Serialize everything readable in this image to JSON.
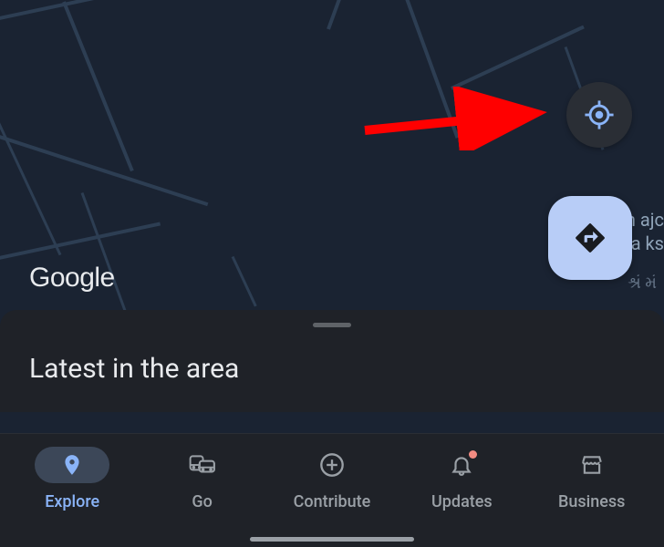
{
  "map": {
    "attribution": "Google",
    "poi_label": "Sh          ajc\nMa          ks",
    "poi_sub": "શ્રં\nમં"
  },
  "controls": {
    "locate_icon": "locate-crosshair-icon",
    "directions_icon": "directions-icon"
  },
  "sheet": {
    "title": "Latest in the area"
  },
  "nav": {
    "items": [
      {
        "id": "explore",
        "label": "Explore",
        "icon": "pin-icon",
        "active": true,
        "notification": false
      },
      {
        "id": "go",
        "label": "Go",
        "icon": "transit-icon",
        "active": false,
        "notification": false
      },
      {
        "id": "contribute",
        "label": "Contribute",
        "icon": "plus-circle-icon",
        "active": false,
        "notification": false
      },
      {
        "id": "updates",
        "label": "Updates",
        "icon": "bell-icon",
        "active": false,
        "notification": true
      },
      {
        "id": "business",
        "label": "Business",
        "icon": "storefront-icon",
        "active": false,
        "notification": false
      }
    ]
  },
  "annotation": {
    "target": "locate-button",
    "color": "#ff0000"
  }
}
